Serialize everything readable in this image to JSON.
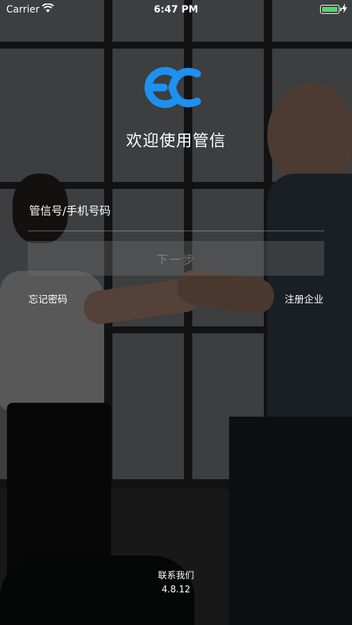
{
  "status_bar": {
    "carrier": "Carrier",
    "time": "6:47 PM",
    "battery_color": "#4cd964"
  },
  "logo": {
    "icon": "guanxin-logo-icon",
    "color": "#1e90f0"
  },
  "welcome_title": "欢迎使用管信",
  "login_form": {
    "account_placeholder": "管信号/手机号码",
    "account_value": "",
    "next_button_label": "下一步",
    "forgot_password_label": "忘记密码",
    "register_company_label": "注册企业"
  },
  "footer": {
    "contact_label": "联系我们",
    "version": "4.8.12"
  }
}
